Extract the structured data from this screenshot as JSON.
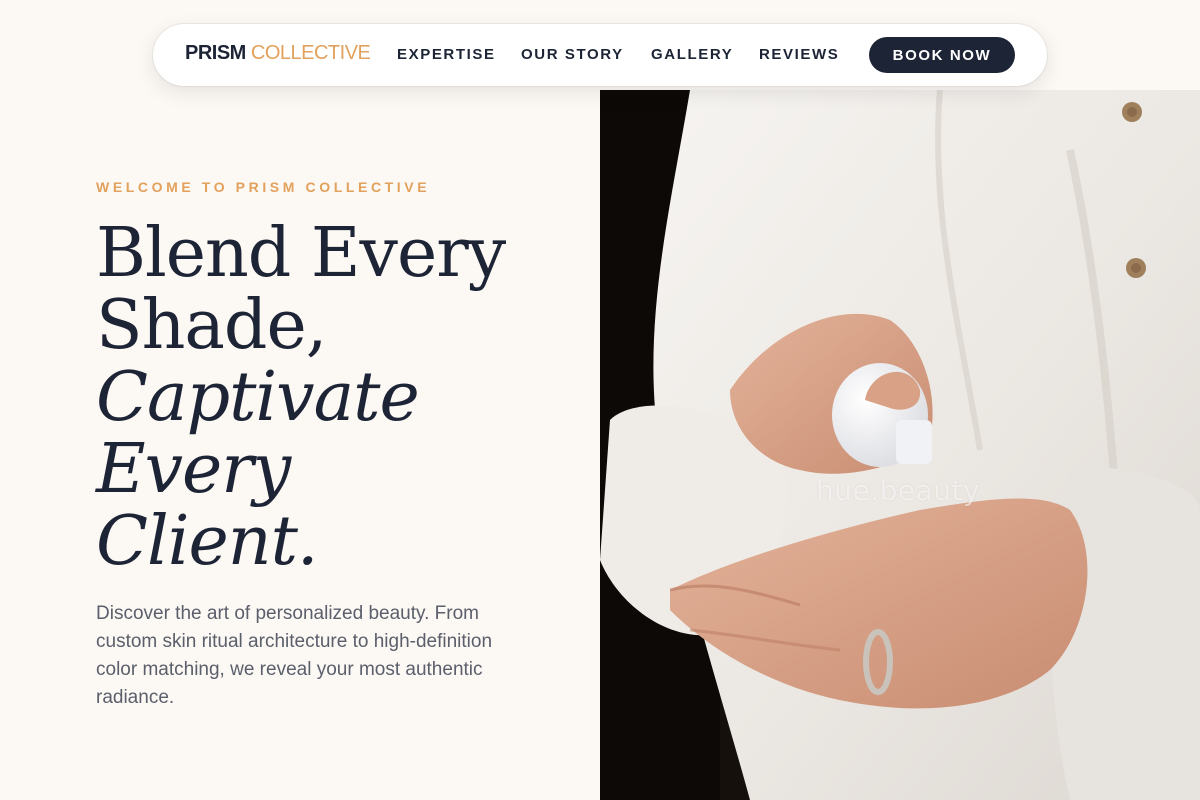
{
  "nav": {
    "logo_primary": "PRISM",
    "logo_accent": "COLLECTIVE",
    "links": [
      "EXPERTISE",
      "OUR STORY",
      "GALLERY",
      "REVIEWS"
    ],
    "cta_label": "BOOK NOW"
  },
  "hero": {
    "eyebrow": "WELCOME TO PRISM COLLECTIVE",
    "headline_lines": [
      "Blend Every",
      "Shade,",
      "Captivate",
      "Every",
      "Client."
    ],
    "description": "Discover the art of personalized beauty. From custom skin ritual architecture to high-definition color matching, we reveal your most authentic radiance."
  },
  "photo": {
    "watermark": "hue.beauty",
    "subject": "hands applying white cream from a pump bottle"
  },
  "colors": {
    "navy": "#1c2436",
    "accent": "#e2a15c",
    "background": "#fcf8f4",
    "body_text": "#5a5f6b"
  }
}
